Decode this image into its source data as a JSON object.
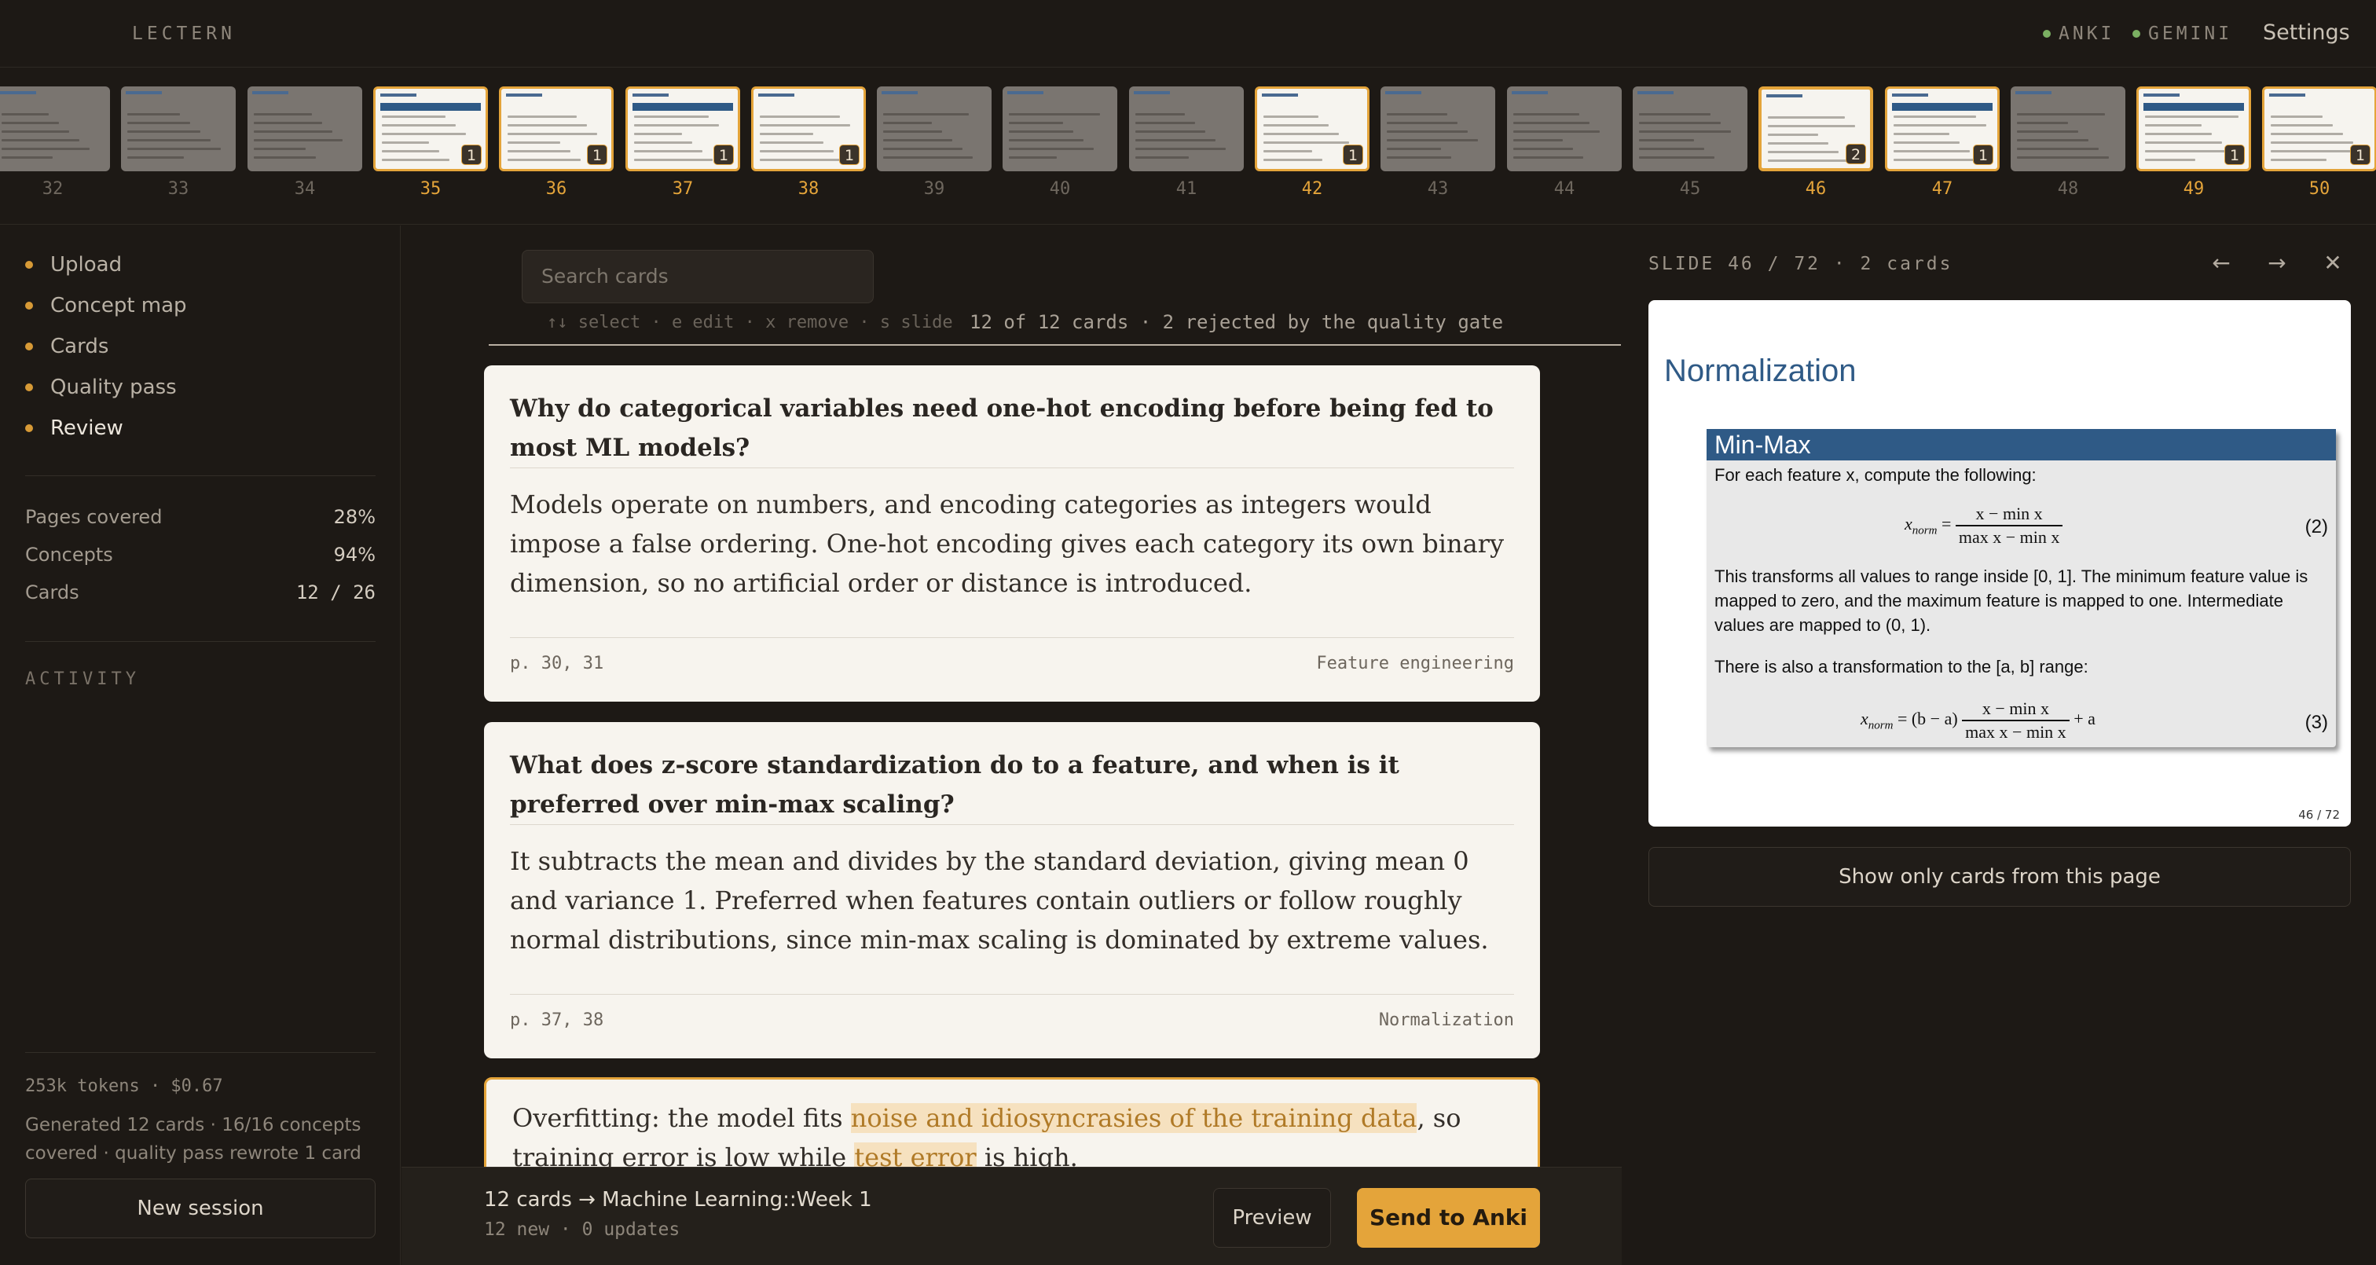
{
  "app": {
    "name": "LECTERN"
  },
  "status": [
    {
      "label": "ANKI",
      "color": "#7bb062"
    },
    {
      "label": "GEMINI",
      "color": "#7bb062"
    }
  ],
  "settings_label": "Settings",
  "filmstrip": {
    "thumbs": [
      {
        "page": "32",
        "cards": "",
        "has_cards": false
      },
      {
        "page": "33",
        "cards": "",
        "has_cards": false
      },
      {
        "page": "34",
        "cards": "",
        "has_cards": false
      },
      {
        "page": "35",
        "cards": "1",
        "has_cards": true
      },
      {
        "page": "36",
        "cards": "1",
        "has_cards": true
      },
      {
        "page": "37",
        "cards": "1",
        "has_cards": true
      },
      {
        "page": "38",
        "cards": "1",
        "has_cards": true
      },
      {
        "page": "39",
        "cards": "",
        "has_cards": false
      },
      {
        "page": "40",
        "cards": "",
        "has_cards": false
      },
      {
        "page": "41",
        "cards": "",
        "has_cards": false
      },
      {
        "page": "42",
        "cards": "1",
        "has_cards": true
      },
      {
        "page": "43",
        "cards": "",
        "has_cards": false
      },
      {
        "page": "44",
        "cards": "",
        "has_cards": false
      },
      {
        "page": "45",
        "cards": "",
        "has_cards": false
      },
      {
        "page": "46",
        "cards": "2",
        "has_cards": true,
        "current": true
      },
      {
        "page": "47",
        "cards": "1",
        "has_cards": true
      },
      {
        "page": "48",
        "cards": "",
        "has_cards": false
      },
      {
        "page": "49",
        "cards": "1",
        "has_cards": true
      },
      {
        "page": "50",
        "cards": "1",
        "has_cards": true
      }
    ]
  },
  "sidebar": {
    "nav": [
      {
        "label": "Upload"
      },
      {
        "label": "Concept map"
      },
      {
        "label": "Cards"
      },
      {
        "label": "Quality pass"
      },
      {
        "label": "Review"
      }
    ],
    "stats": [
      {
        "label": "Pages covered",
        "value": "28%"
      },
      {
        "label": "Concepts",
        "value": "94%"
      },
      {
        "label": "Cards",
        "value": "12 / 26"
      }
    ],
    "activity_label": "ACTIVITY",
    "tokens": "253k tokens · $0.67",
    "summary": "Generated 12 cards · 16/16 concepts covered · quality pass rewrote 1 card",
    "new_session": "New session"
  },
  "center": {
    "search_placeholder": "Search cards",
    "hints": "↑↓ select · e edit · x remove · s slide",
    "count": "12 of 12 cards · 2 rejected by the quality gate",
    "cards": [
      {
        "question": "Why do categorical variables need one-hot encoding before being fed to most ML models?",
        "answer": "Models operate on numbers, and encoding categories as integers would impose a false ordering. One-hot encoding gives each category its own binary dimension, so no artificial order or distance is introduced.",
        "pages": "p. 30, 31",
        "concept": "Feature engineering"
      },
      {
        "question": "What does z-score standardization do to a feature, and when is it preferred over min-max scaling?",
        "answer": "It subtracts the mean and divides by the standard deviation, giving mean 0 and variance 1. Preferred when features contain outliers or follow roughly normal distributions, since min-max scaling is dominated by extreme values.",
        "pages": "p. 37, 38",
        "concept": "Normalization"
      },
      {
        "cloze_pre": "Overfitting: the model fits ",
        "cloze_1": "noise and idiosyncrasies of the training data",
        "cloze_mid": ", so training error is low while ",
        "cloze_2": "test error",
        "cloze_post": " is high."
      }
    ],
    "deck": "12 cards → Machine Learning::Week 1",
    "deck_meta": "12 new · 0 updates",
    "preview": "Preview",
    "send": "Send to Anki"
  },
  "slide_panel": {
    "label": "SLIDE 46 / 72 · 2 cards",
    "title": "Normalization",
    "box_title": "Min-Max",
    "line1": "For each feature x, compute the following:",
    "eq2_lhs": "x",
    "eq2_sub": "norm",
    "eq2_num": "x − min x",
    "eq2_den": "max x − min x",
    "eq2_no": "(2)",
    "para1": "This transforms all values to range inside [0, 1]. The minimum feature value is mapped to zero, and the maximum feature is mapped to one. Intermediate values are mapped to (0, 1).",
    "line2": "There is also a transformation to the [a, b] range:",
    "eq3_lhs": "x",
    "eq3_sub": "norm",
    "eq3_pre": "= (b − a)",
    "eq3_num": "x − min x",
    "eq3_den": "max x − min x",
    "eq3_post": "+ a",
    "eq3_no": "(3)",
    "page_num": "46 / 72",
    "filter": "Show only cards from this page"
  }
}
